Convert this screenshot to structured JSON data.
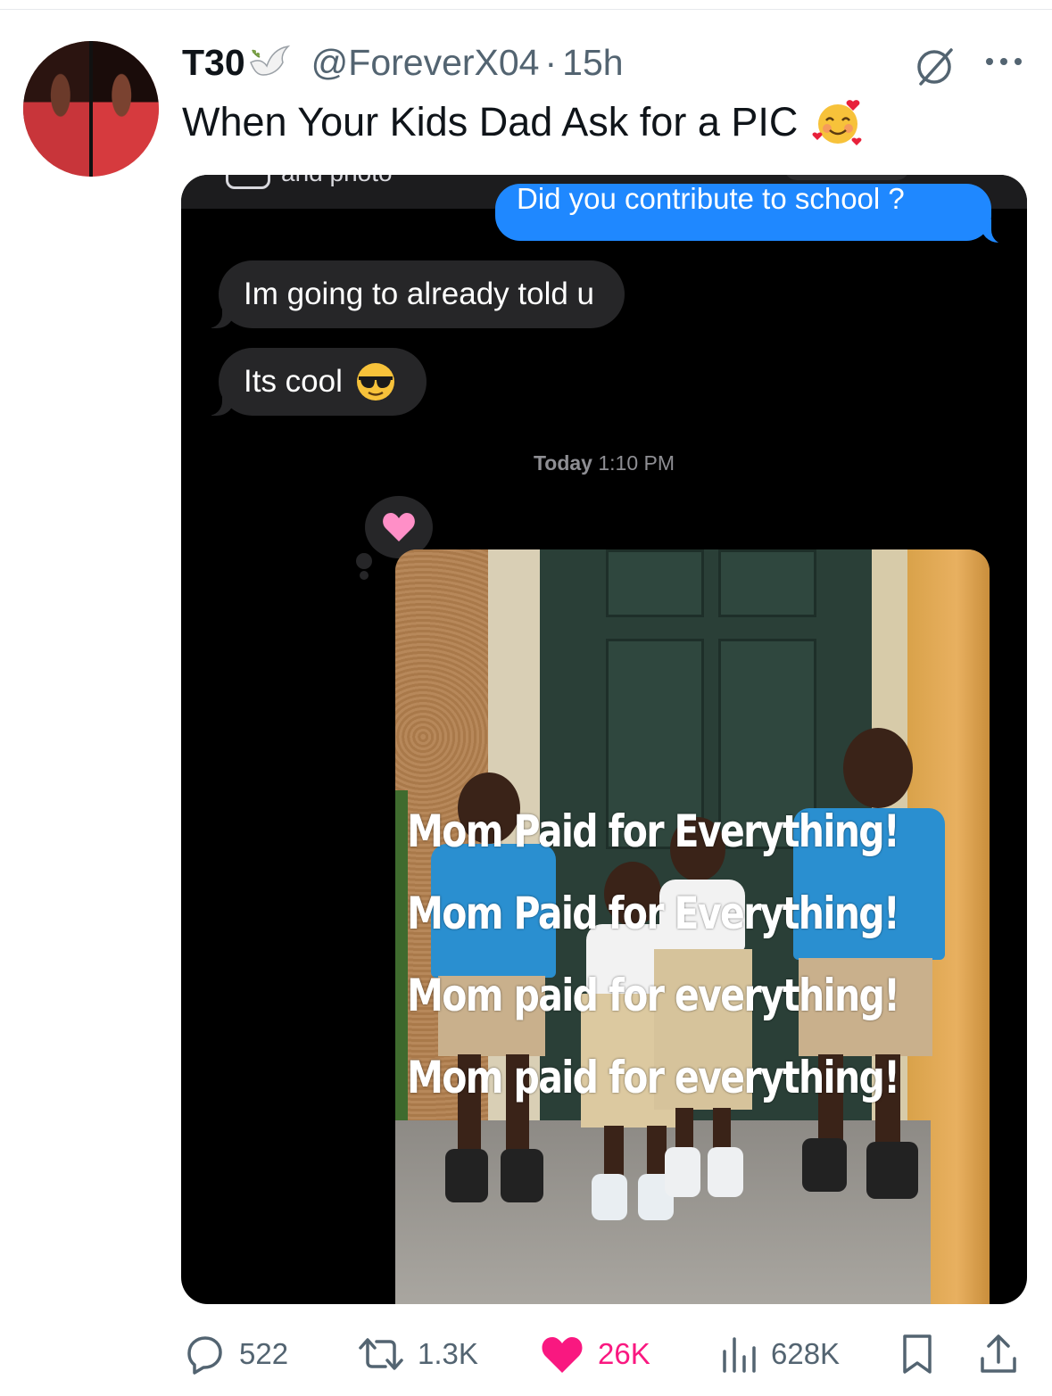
{
  "post": {
    "display_name": "T30",
    "handle": "@ForeverX04",
    "separator": "·",
    "time": "15h",
    "text": "When Your Kids Dad Ask for a PIC",
    "emoji": "smiling-face-with-hearts"
  },
  "chat": {
    "top_cutoff_text": "and photo",
    "outgoing_message": "Did you contribute to school ?",
    "incoming_messages": [
      {
        "text": "Im going to already told u"
      },
      {
        "text": "Its cool",
        "emoji": "smiling-face-with-sunglasses"
      }
    ],
    "timestamp_day": "Today",
    "timestamp_time": "1:10 PM",
    "reaction": "heart",
    "reaction_color": "#ff8fc7",
    "photo_overlay_lines": [
      "Mom Paid for Everything!",
      "Mom Paid for Everything!",
      "Mom paid for everything!",
      "Mom paid for everything!"
    ]
  },
  "actions": {
    "replies": "522",
    "reposts": "1.3K",
    "likes": "26K",
    "views": "628K"
  },
  "colors": {
    "bubble_out": "#1f88ff",
    "bubble_in": "#262628",
    "like": "#f91880",
    "secondary_text": "#536471"
  }
}
